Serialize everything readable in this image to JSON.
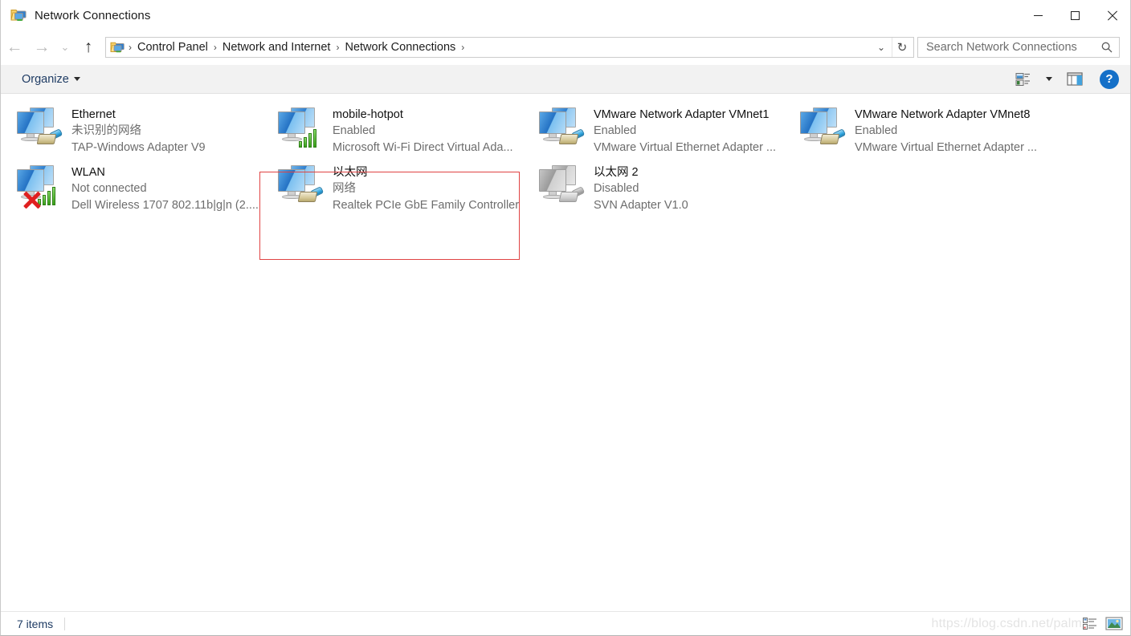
{
  "window": {
    "title": "Network Connections",
    "title_icon": "network-folder-icon",
    "minimize_label": "Minimize",
    "maximize_label": "Maximize",
    "close_label": "Close"
  },
  "nav": {
    "back_label": "Back",
    "forward_label": "Forward",
    "recent_label": "Recent locations",
    "up_label": "Up",
    "breadcrumbs": [
      {
        "label": "Control Panel"
      },
      {
        "label": "Network and Internet"
      },
      {
        "label": "Network Connections"
      }
    ],
    "separator": "›",
    "dropdown_glyph": "⌄",
    "refresh_glyph": "↻"
  },
  "search": {
    "placeholder": "Search Network Connections",
    "value": "",
    "icon": "search-icon"
  },
  "commandbar": {
    "organize_label": "Organize",
    "view_options_label": "Change your view",
    "preview_pane_label": "Show the preview pane",
    "help_label": "?"
  },
  "connections": [
    {
      "name": "Ethernet",
      "status": "未识别的网络",
      "device": "TAP-Windows Adapter V9",
      "icon": "ethernet-adapter-icon",
      "overlay": "rj45",
      "disabled": false,
      "error": false
    },
    {
      "name": "WLAN",
      "status": "Not connected",
      "device": "Dell Wireless 1707 802.11b|g|n (2....",
      "icon": "wireless-adapter-icon",
      "overlay": "bars",
      "disabled": false,
      "error": true
    },
    {
      "name": "mobile-hotpot",
      "status": "Enabled",
      "device": "Microsoft Wi-Fi Direct Virtual Ada...",
      "icon": "wireless-adapter-icon",
      "overlay": "bars",
      "disabled": false,
      "error": false
    },
    {
      "name": "以太网",
      "status": "网络",
      "device": "Realtek PCIe GbE Family Controller",
      "icon": "ethernet-adapter-icon",
      "overlay": "rj45",
      "disabled": false,
      "error": false
    },
    {
      "name": "VMware Network Adapter VMnet1",
      "status": "Enabled",
      "device": "VMware Virtual Ethernet Adapter ...",
      "icon": "ethernet-adapter-icon",
      "overlay": "rj45",
      "disabled": false,
      "error": false
    },
    {
      "name": "以太网 2",
      "status": "Disabled",
      "device": "SVN Adapter V1.0",
      "icon": "ethernet-adapter-icon",
      "overlay": "rj45",
      "disabled": true,
      "error": false
    },
    {
      "name": "VMware Network Adapter VMnet8",
      "status": "Enabled",
      "device": "VMware Virtual Ethernet Adapter ...",
      "icon": "ethernet-adapter-icon",
      "overlay": "rj45",
      "disabled": false,
      "error": false
    }
  ],
  "annotation": {
    "target": "mobile-hotpot",
    "color": "#e04343"
  },
  "statusbar": {
    "item_count": "7 items",
    "watermark": "https://blog.csdn.net/palm",
    "details_view_label": "Details view",
    "large_icons_view_label": "Large icons view"
  },
  "colors": {
    "accent": "#1570c8",
    "link": "#1f3c64",
    "annotation": "#e04343",
    "status_text": "#6d6d6d"
  }
}
